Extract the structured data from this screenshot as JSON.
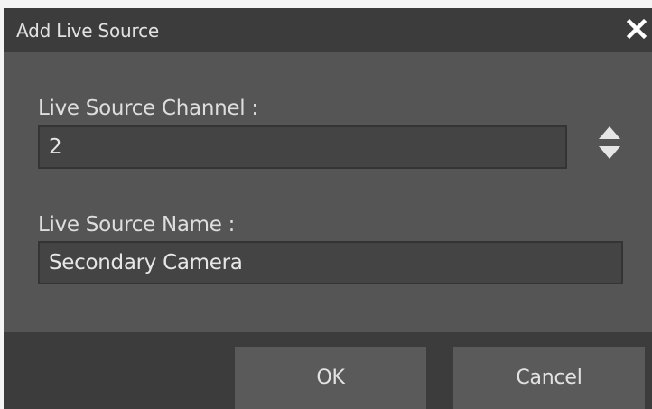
{
  "dialog": {
    "title": "Add Live Source",
    "close_icon": "close-icon"
  },
  "channel": {
    "label": "Live Source Channel :",
    "value": "2",
    "spinner_icon": "up-down-spinner-icon"
  },
  "name": {
    "label": "Live Source Name :",
    "value": "Secondary Camera"
  },
  "buttons": {
    "ok_label": "OK",
    "cancel_label": "Cancel"
  },
  "colors": {
    "titlebar": "#3c3c3c",
    "body": "#555555",
    "field": "#444444",
    "button": "#5a5a5a",
    "text": "#e2e2e2"
  }
}
